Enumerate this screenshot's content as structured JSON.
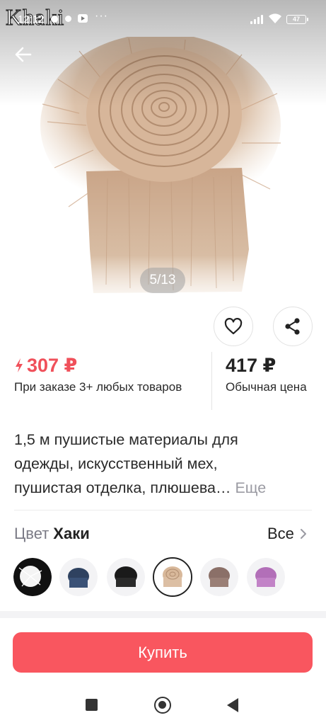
{
  "status_bar": {
    "watermark": "Khaki",
    "time": "12:12",
    "battery": "47"
  },
  "gallery": {
    "counter": "5/13"
  },
  "icons": {
    "back": "arrow-left-icon",
    "favorite": "heart-icon",
    "share": "share-icon",
    "sale": "lightning-icon",
    "more": "chevron-right-icon"
  },
  "price": {
    "sale_value": "307 ₽",
    "sale_note": "При заказе 3+ любых товаров",
    "regular_value": "417 ₽",
    "regular_note": "Обычная цена"
  },
  "product": {
    "title_lines": [
      "1,5 м пушистые материалы для",
      "одежды, искусственный мех,",
      "пушистая отделка, плюшева…"
    ],
    "more_label": "Еще"
  },
  "color": {
    "label": "Цвет",
    "value": "Хаки",
    "all_label": "Все",
    "swatches": [
      "white",
      "navy",
      "black",
      "khaki",
      "coffee",
      "purple"
    ]
  },
  "buy_button": "Купить",
  "colors": {
    "accent": "#f9565f",
    "sale_price": "#f0505a",
    "fur_khaki": "#d8b89a"
  }
}
